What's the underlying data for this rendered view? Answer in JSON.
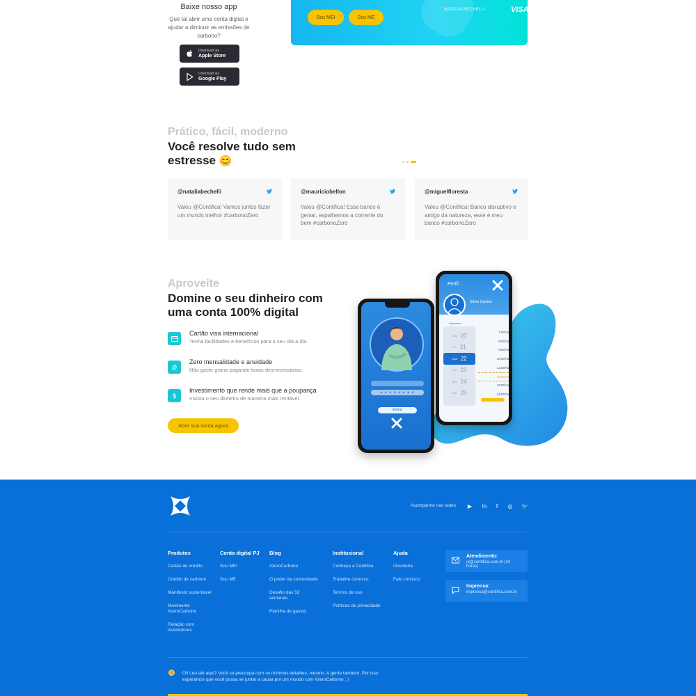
{
  "app": {
    "title": "Baixe nosso app",
    "description": "Que tal abrir uma conta digital e ajudar a diminuir as emissões de carbono?",
    "apple": {
      "small": "Download via",
      "big": "Apple Store"
    },
    "google": {
      "small": "Download via",
      "big": "Google Play"
    }
  },
  "card_banner": {
    "buttons": [
      "Sou MEI",
      "Sou ME"
    ],
    "holder": "NATALIA BECHELLI",
    "brand": "VISA"
  },
  "testimonials": {
    "kicker": "Prático, fácil, moderno",
    "headline_1": "Você resolve tudo sem",
    "headline_2": "estresse",
    "emoji": "😊",
    "items": [
      {
        "handle": "@nataliabechelli",
        "text": "Valeu @Contifica! Vamos juntos fazer um mundo melhor #carbonoZero"
      },
      {
        "handle": "@mauriciobellon",
        "text": "Valeu @Contifica! Esse banco é genial, espalhemos a corrente do bem #carbonoZero"
      },
      {
        "handle": "@miguelfloresta",
        "text": "Valeu @Contifica! Banco disruptivo e amigo da natureza, esse é meu banco #carbonoZero"
      }
    ]
  },
  "benefits": {
    "kicker": "Aproveite",
    "headline_1": "Domine o seu dinheiro com",
    "headline_2": "uma conta 100% digital",
    "items": [
      {
        "icon": "card-icon",
        "title": "Cartão visa internacional",
        "desc": "Tenha facilidades e benefícios para o seu dia a dia."
      },
      {
        "icon": "zero-icon",
        "title": "Zero mensalidade e anuidade",
        "desc": "Não gaste grana pagando taxas desnecessárias."
      },
      {
        "icon": "dollar-icon",
        "title": "Investimento que rende mais que a poupança",
        "desc": "Invista o seu dinheiro de maneira mais rentável."
      }
    ],
    "cta": "Abra sua conta agora"
  },
  "phone_left": {
    "login_button": "Entrar"
  },
  "phone_right": {
    "screen_title": "Perfil",
    "user_name": "Silvio Santos",
    "month": "Setembro",
    "days": [
      {
        "wd": "Seg",
        "num": "20"
      },
      {
        "wd": "Ter",
        "num": "21"
      },
      {
        "wd": "Qua",
        "num": "22"
      },
      {
        "wd": "Qui",
        "num": "23"
      },
      {
        "wd": "Sex",
        "num": "24"
      },
      {
        "wd": "Sab",
        "num": "25"
      }
    ],
    "times": [
      "7:00 hs",
      "8:00 hs",
      "9:00 hs",
      "10:00 hs",
      "11:00 hs",
      "12:00 hs",
      "13:00 hs",
      "14:00 hs"
    ]
  },
  "footer": {
    "follow_label": "Acompanhe nas redes",
    "social": [
      {
        "name": "youtube-icon",
        "glyph": "▶"
      },
      {
        "name": "linkedin-icon",
        "glyph": "in"
      },
      {
        "name": "facebook-icon",
        "glyph": "f"
      },
      {
        "name": "instagram-icon",
        "glyph": "◎"
      },
      {
        "name": "twitter-icon",
        "glyph": "🐦"
      }
    ],
    "columns": [
      {
        "heading": "Produtos",
        "links": [
          "Cartão de crédito",
          "Crédito de carbono",
          "Manifesto sustentável",
          "Movimento #zeroCarbono",
          "Relação com investidores"
        ]
      },
      {
        "heading": "Conta digital PJ",
        "links": [
          "Sou MEI",
          "Sou ME"
        ]
      },
      {
        "heading": "Blog",
        "links": [
          "#zeroCarbono",
          "O poder da comunidade",
          "Desafio das 52 semanas",
          "Planilha de gastos"
        ]
      },
      {
        "heading": "Institucional",
        "links": [
          "Conheça a Contifica",
          "Trabalhe conosco",
          "Termos de uso",
          "Políticas de privacidade"
        ]
      },
      {
        "heading": "Ajuda",
        "links": [
          "Ouvidoria",
          "Fale conosco"
        ]
      }
    ],
    "contact": [
      {
        "icon": "mail-icon",
        "heading": "Atendimento:",
        "text": "oi@contifica.com.br (24 horas)"
      },
      {
        "icon": "chat-icon",
        "heading": "Imprensa:",
        "text": "imprensa@contifica.com.br"
      }
    ],
    "note": "Oi! Leu até aqui? Você se preocupa com os mínimos detalhes, mesmo. A gente também. Por isso esperamos que você possa se juntar a causa por um mundo com #zeroCarbono ; )"
  },
  "colors": {
    "accent_yellow": "#f8c300",
    "footer_blue": "#0a70d9",
    "teal": "#1cc6d5"
  }
}
